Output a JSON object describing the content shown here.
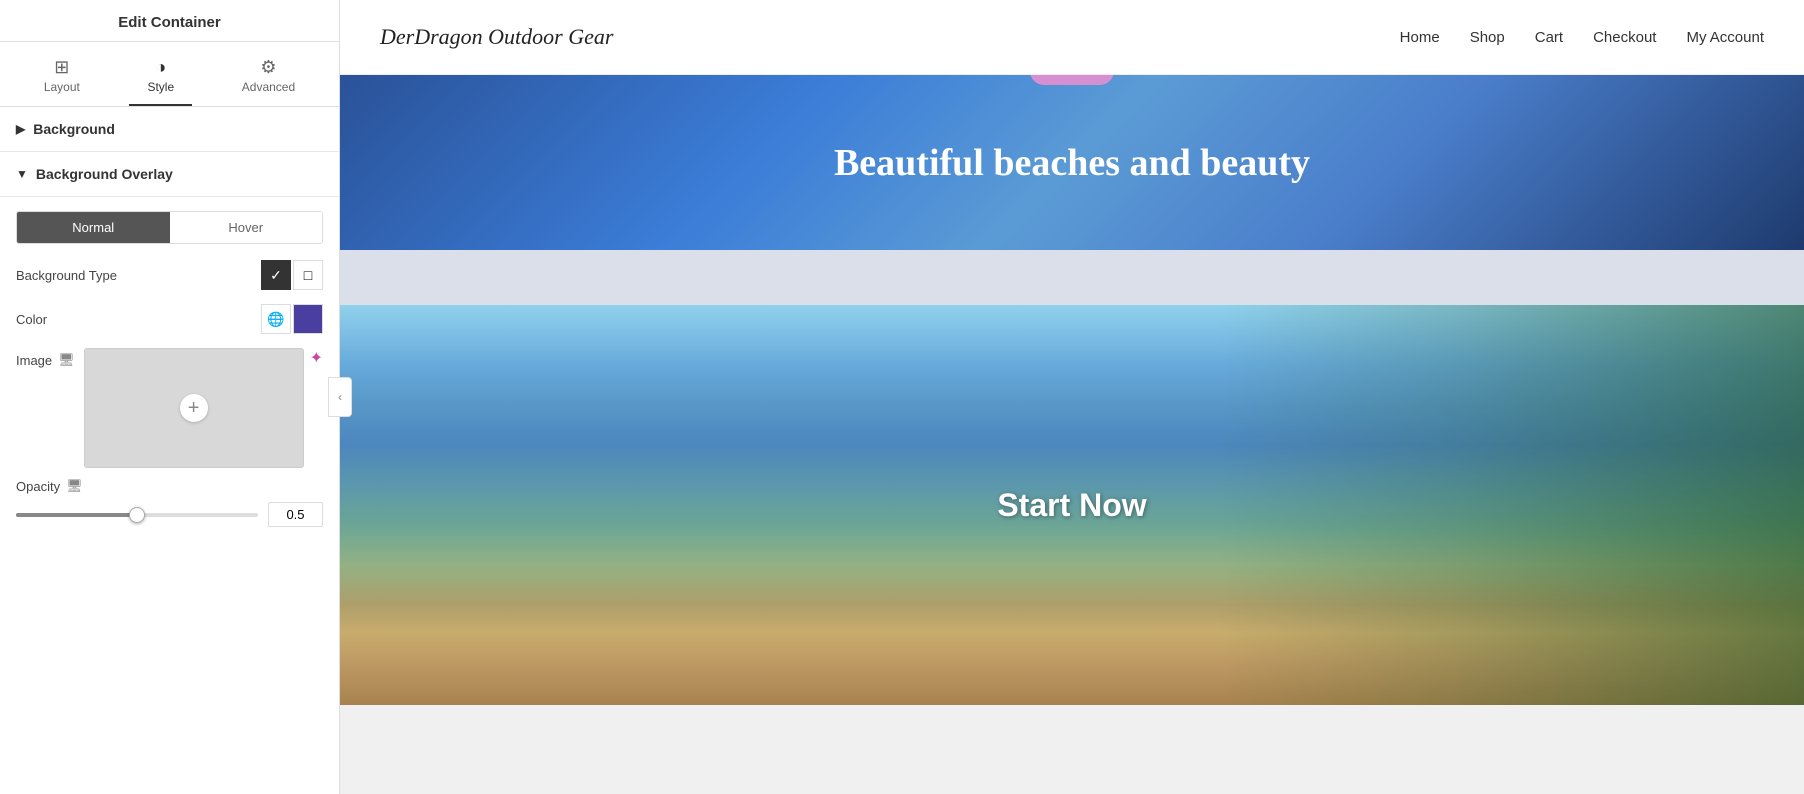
{
  "panel": {
    "title": "Edit Container",
    "tabs": [
      {
        "id": "layout",
        "label": "Layout",
        "icon": "⊞"
      },
      {
        "id": "style",
        "label": "Style",
        "icon": "◑"
      },
      {
        "id": "advanced",
        "label": "Advanced",
        "icon": "⚙"
      }
    ],
    "active_tab": "style",
    "sections": {
      "background": {
        "label": "Background",
        "arrow": "▶"
      },
      "background_overlay": {
        "label": "Background Overlay",
        "arrow": "▼"
      }
    },
    "overlay": {
      "toggle": {
        "normal": "Normal",
        "hover": "Hover",
        "active": "normal"
      },
      "background_type": {
        "label": "Background Type",
        "options": [
          {
            "id": "fill",
            "icon": "✓",
            "active": true
          },
          {
            "id": "none",
            "icon": "□",
            "active": false
          }
        ]
      },
      "color": {
        "label": "Color",
        "globe_icon": "🌐",
        "swatch_color": "#4a3fa0"
      },
      "image": {
        "label": "Image",
        "monitor_icon": "🖥",
        "magic_icon": "✦"
      },
      "opacity": {
        "label": "Opacity",
        "monitor_icon": "🖥",
        "value": "0.5",
        "slider_percent": 50
      }
    }
  },
  "nav": {
    "site_title": "DerDragon Outdoor Gear",
    "links": [
      {
        "label": "Home"
      },
      {
        "label": "Shop"
      },
      {
        "label": "Cart"
      },
      {
        "label": "Checkout"
      },
      {
        "label": "My Account"
      }
    ]
  },
  "toolbar": {
    "add": "+",
    "move": "⠿",
    "close": "×"
  },
  "canvas": {
    "hero": {
      "text": "Beautiful beaches and beauty"
    },
    "beach": {
      "text": "Start Now"
    }
  }
}
